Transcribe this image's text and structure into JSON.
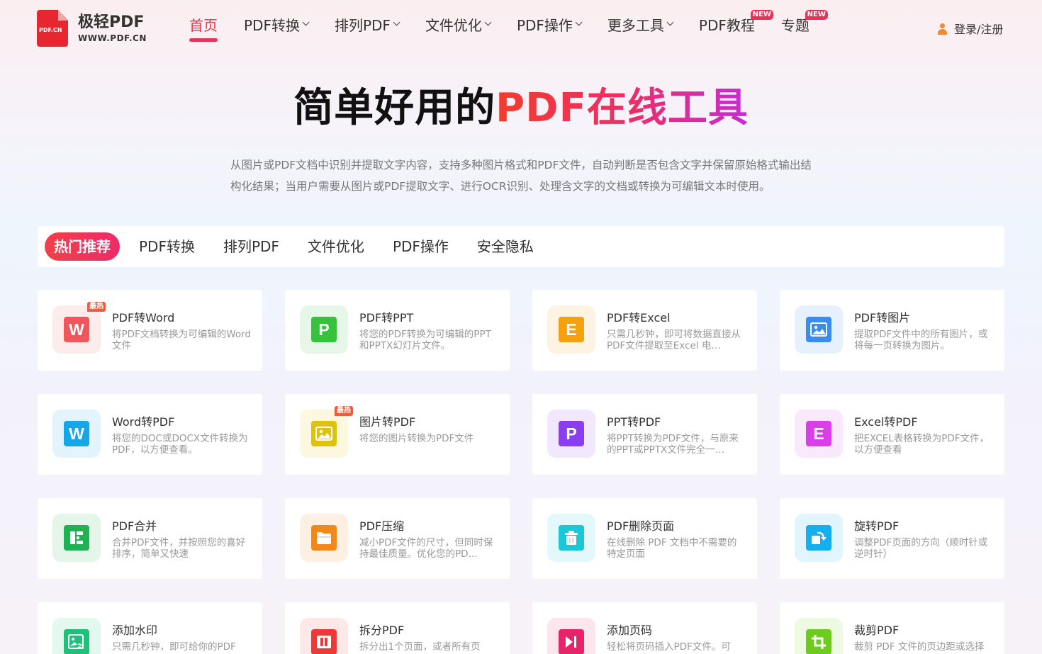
{
  "logo": {
    "mark_text": "PDF.CN",
    "name": "极轻PDF",
    "url": "WWW.PDF.CN"
  },
  "nav": {
    "items": [
      {
        "label": "首页",
        "dropdown": false,
        "new": false,
        "active": true
      },
      {
        "label": "PDF转换",
        "dropdown": true,
        "new": false
      },
      {
        "label": "排列PDF",
        "dropdown": true,
        "new": false
      },
      {
        "label": "文件优化",
        "dropdown": true,
        "new": false
      },
      {
        "label": "PDF操作",
        "dropdown": true,
        "new": false
      },
      {
        "label": "更多工具",
        "dropdown": true,
        "new": false
      },
      {
        "label": "PDF教程",
        "dropdown": false,
        "new": true
      },
      {
        "label": "专题",
        "dropdown": false,
        "new": true
      }
    ],
    "new_badge": "NEW",
    "login": "登录/注册"
  },
  "hero": {
    "title_plain": "简单好用的",
    "title_highlight": "PDF在线工具",
    "description": "从图片或PDF文档中识别并提取文字内容，支持多种图片格式和PDF文件，自动判断是否包含文字并保留原始格式输出结构化结果；当用户需要从图片或PDF提取文字、进行OCR识别、处理含文字的文档或转换为可编辑文本时使用。"
  },
  "tabs": [
    "热门推荐",
    "PDF转换",
    "排列PDF",
    "文件优化",
    "PDF操作",
    "安全隐私"
  ],
  "hot_badge": "最热",
  "colors": {
    "accent": "#e8325a",
    "brand_red": "#e8262f"
  },
  "tools": [
    {
      "title": "PDF转Word",
      "desc": "将PDF文档转换为可编辑的Word文件",
      "glyph": "W",
      "icon": "word-icon",
      "color": "#f0575b",
      "bg": "#fdecec",
      "hot": true
    },
    {
      "title": "PDF转PPT",
      "desc": "将您的PDF转换为可编辑的PPT和PPTX幻灯片文件。",
      "glyph": "P",
      "icon": "ppt-icon",
      "color": "#36c23c",
      "bg": "#e6f7e7",
      "hot": false
    },
    {
      "title": "PDF转Excel",
      "desc": "只需几秒钟，即可将数据直接从PDF文件提取至Excel 电…",
      "glyph": "E",
      "icon": "excel-icon",
      "color": "#f5a10f",
      "bg": "#fdf3e3",
      "hot": false
    },
    {
      "title": "PDF转图片",
      "desc": "提取PDF文件中的所有图片，或将每一页转换为图片。",
      "glyph": "",
      "icon": "image-icon",
      "color": "#3a8cf2",
      "bg": "#e6f1fd",
      "hot": false
    },
    {
      "title": "Word转PDF",
      "desc": "将您的DOC或DOCX文件转换为PDF，以方便查看。",
      "glyph": "W",
      "icon": "word-icon",
      "color": "#17a6e8",
      "bg": "#e3f4fc",
      "hot": false
    },
    {
      "title": "图片转PDF",
      "desc": "将您的图片转换为PDF文件",
      "glyph": "",
      "icon": "image-icon",
      "color": "#dfc20b",
      "bg": "#fbf8df",
      "hot": true
    },
    {
      "title": "PPT转PDF",
      "desc": "将PPT转换为PDF文件，与原来的PPT或PPTX文件完全一…",
      "glyph": "P",
      "icon": "ppt-icon",
      "color": "#8a3ef0",
      "bg": "#f1e8fd",
      "hot": false
    },
    {
      "title": "Excel转PDF",
      "desc": "把EXCEL表格转换为PDF文件，以方便查看",
      "glyph": "E",
      "icon": "excel-icon",
      "color": "#d93ee8",
      "bg": "#fae8fc",
      "hot": false
    },
    {
      "title": "PDF合并",
      "desc": "合并PDF文件，并按照您的喜好排序，简单又快速",
      "glyph": "",
      "icon": "merge-icon",
      "color": "#1fb154",
      "bg": "#e4f6ea",
      "hot": false
    },
    {
      "title": "PDF压缩",
      "desc": "减小PDF文件的尺寸，但同时保持最佳质量。优化您的PD…",
      "glyph": "",
      "icon": "folder-icon",
      "color": "#f2871a",
      "bg": "#fdf0e3",
      "hot": false
    },
    {
      "title": "PDF删除页面",
      "desc": "在线删除 PDF 文档中不需要的特定页面",
      "glyph": "",
      "icon": "trash-icon",
      "color": "#1ac7d6",
      "bg": "#e2f8fa",
      "hot": false
    },
    {
      "title": "旋转PDF",
      "desc": "调整PDF页面的方向（顺时针或逆时针）",
      "glyph": "",
      "icon": "rotate-icon",
      "color": "#14b0ee",
      "bg": "#e2f4fc",
      "hot": false
    },
    {
      "title": "添加水印",
      "desc": "只需几秒钟，即可给你的PDF",
      "glyph": "",
      "icon": "watermark-icon",
      "color": "#1fc07a",
      "bg": "#e3f8ee",
      "hot": false
    },
    {
      "title": "拆分PDF",
      "desc": "拆分出1个页面，或者所有页",
      "glyph": "",
      "icon": "split-icon",
      "color": "#ea3a3a",
      "bg": "#fde8e8",
      "hot": false
    },
    {
      "title": "添加页码",
      "desc": "轻松将页码插入PDF文件。可",
      "glyph": "",
      "icon": "page-number-icon",
      "color": "#e8236a",
      "bg": "#fce6ee",
      "hot": false
    },
    {
      "title": "裁剪PDF",
      "desc": "裁剪 PDF 文件的页边距或选择",
      "glyph": "",
      "icon": "crop-icon",
      "color": "#6ccb1e",
      "bg": "#eef9e2",
      "hot": false
    }
  ]
}
